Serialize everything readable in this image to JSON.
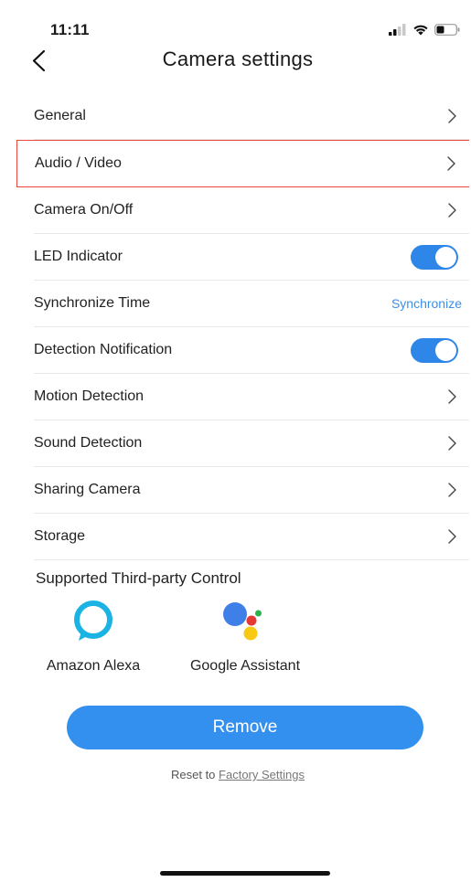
{
  "status_bar": {
    "time": "11:11",
    "icons": [
      "signal-icon",
      "wifi-icon",
      "battery-icon"
    ]
  },
  "header": {
    "title": "Camera settings",
    "back_icon": "chevron-left-icon"
  },
  "settings": {
    "items": [
      {
        "label": "General",
        "control": "chevron"
      },
      {
        "label": "Audio / Video",
        "control": "chevron",
        "highlighted": true
      },
      {
        "label": "Camera On/Off",
        "control": "chevron"
      },
      {
        "label": "LED Indicator",
        "control": "toggle",
        "value": true
      },
      {
        "label": "Synchronize Time",
        "control": "link",
        "action_label": "Synchronize"
      },
      {
        "label": "Detection Notification",
        "control": "toggle",
        "value": true
      },
      {
        "label": "Motion Detection",
        "control": "chevron"
      },
      {
        "label": "Sound Detection",
        "control": "chevron"
      },
      {
        "label": "Sharing Camera",
        "control": "chevron"
      },
      {
        "label": "Storage",
        "control": "chevron"
      }
    ]
  },
  "third_party": {
    "title": "Supported Third-party Control",
    "items": [
      {
        "label": "Amazon Alexa",
        "icon": "alexa-icon"
      },
      {
        "label": "Google Assistant",
        "icon": "google-assistant-icon"
      }
    ]
  },
  "actions": {
    "remove_label": "Remove",
    "reset_prefix": "Reset to",
    "reset_link": "Factory Settings"
  },
  "colors": {
    "accent": "#3390ee",
    "toggle_on": "#2f86e9",
    "highlight_border": "#e8463f",
    "alexa": "#1bb3e3",
    "google_blue": "#3f7fe8",
    "google_red": "#e53935",
    "google_yellow": "#f6c913",
    "google_green": "#2bb24c"
  }
}
